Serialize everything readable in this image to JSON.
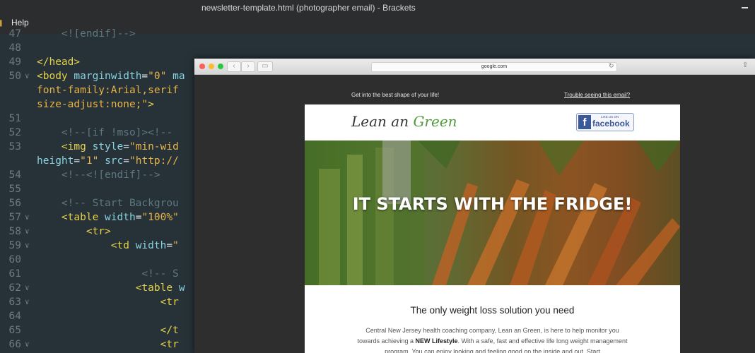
{
  "window": {
    "title": "newsletter-template.html (photographer email) - Brackets"
  },
  "menu": {
    "help": "Help"
  },
  "code_lines": [
    {
      "num": "47",
      "fold": false,
      "html": "<span class='cmt'>    &lt;![endif]--&gt;</span>"
    },
    {
      "num": "48",
      "fold": false,
      "html": ""
    },
    {
      "num": "49",
      "fold": false,
      "html": "<span class='tag'>&lt;/head&gt;</span>"
    },
    {
      "num": "50",
      "fold": true,
      "html": "<span class='tag'>&lt;body</span> <span class='attr'>marginwidth</span><span class='plain'>=</span><span class='str'>\"0\"</span> <span class='attr'>ma</span>"
    },
    {
      "num": "",
      "fold": false,
      "html": "<span class='str'>font-family:Arial,serif</span>"
    },
    {
      "num": "",
      "fold": false,
      "html": "<span class='str'>size-adjust:none;\"</span><span class='tag'>&gt;</span>"
    },
    {
      "num": "51",
      "fold": false,
      "html": ""
    },
    {
      "num": "52",
      "fold": false,
      "html": "<span class='cmt'>    &lt;!--[if !mso]&gt;&lt;!-- </span>"
    },
    {
      "num": "53",
      "fold": false,
      "html": "    <span class='tag'>&lt;img</span> <span class='attr'>style</span><span class='plain'>=</span><span class='str'>\"min-wid</span>"
    },
    {
      "num": "",
      "fold": false,
      "html": "<span class='attr'>height</span><span class='plain'>=</span><span class='str'>\"1\"</span> <span class='attr'>src</span><span class='plain'>=</span><span class='str'>\"http://</span>"
    },
    {
      "num": "54",
      "fold": false,
      "html": "<span class='cmt'>    &lt;!--&lt;![endif]--&gt;</span>"
    },
    {
      "num": "55",
      "fold": false,
      "html": ""
    },
    {
      "num": "56",
      "fold": false,
      "html": "<span class='cmt'>    &lt;!-- Start Backgrou</span>"
    },
    {
      "num": "57",
      "fold": true,
      "html": "    <span class='tag'>&lt;table</span> <span class='attr'>width</span><span class='plain'>=</span><span class='str'>\"100%\"</span>"
    },
    {
      "num": "58",
      "fold": true,
      "html": "        <span class='tag'>&lt;tr&gt;</span>"
    },
    {
      "num": "59",
      "fold": true,
      "html": "            <span class='tag'>&lt;td</span> <span class='attr'>width</span><span class='plain'>=</span><span class='str'>\"</span>"
    },
    {
      "num": "60",
      "fold": false,
      "html": ""
    },
    {
      "num": "61",
      "fold": false,
      "html": "<span class='cmt'>                 &lt;!-- S</span>"
    },
    {
      "num": "62",
      "fold": true,
      "html": "                <span class='tag'>&lt;table</span> <span class='attr'>w</span>"
    },
    {
      "num": "63",
      "fold": true,
      "html": "                    <span class='tag'>&lt;tr</span>"
    },
    {
      "num": "64",
      "fold": false,
      "html": ""
    },
    {
      "num": "65",
      "fold": false,
      "html": "                    <span class='tag'>&lt;/t</span>"
    },
    {
      "num": "66",
      "fold": true,
      "html": "                    <span class='tag'>&lt;tr</span>"
    }
  ],
  "browser": {
    "address": "google.com",
    "preheader_left": "Get into the best shape of your life!",
    "preheader_right": "Trouble seeing this email?"
  },
  "email": {
    "logo_part1": "Lean an ",
    "logo_part2": "Green",
    "fb_like": "LIKE US ON",
    "fb_word": "facebook",
    "fb_f": "f",
    "hero_title": "IT STARTS WITH THE FRIDGE!",
    "headline": "The only weight loss solution you need",
    "body_pre": "Central New Jersey health coaching company, Lean an Green, is here to help monitor you towards achieving a ",
    "body_bold": "NEW Lifestyle",
    "body_post": ". With a safe, fast and effective life long weight management program. You can enjoy looking and feeling good on the inside and out. Start"
  },
  "colors": {
    "editor_bg": "#263238",
    "tag": "#e5d14a",
    "string": "#e8b44a",
    "brand_green": "#4f9a3a",
    "facebook_blue": "#3b5998"
  }
}
